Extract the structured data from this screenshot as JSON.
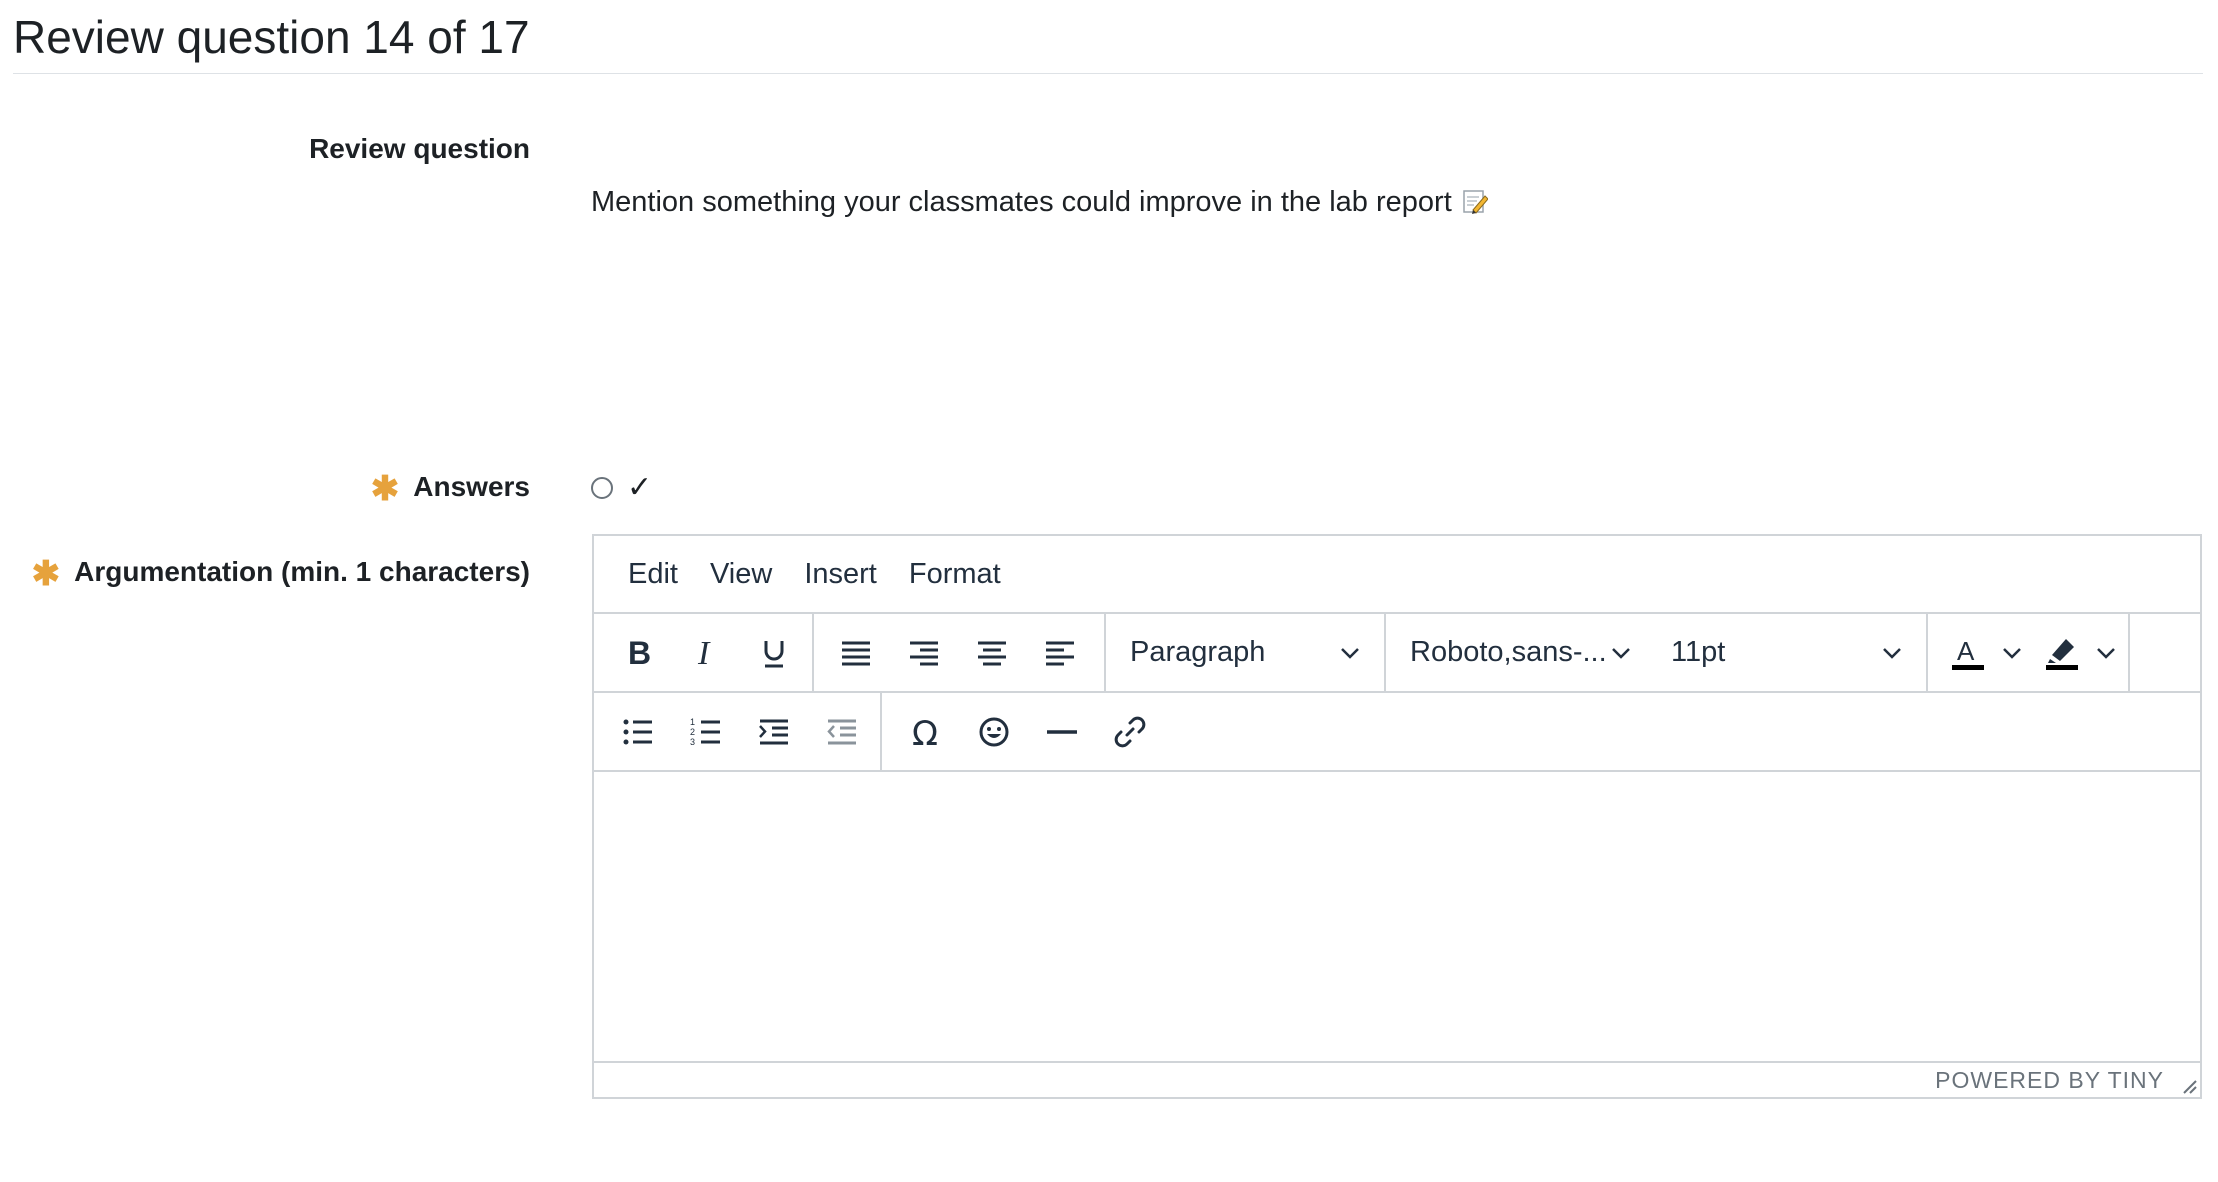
{
  "header": {
    "title": "Review question 14 of 17"
  },
  "question": {
    "label": "Review question",
    "text": "Mention something your classmates could improve in the lab report",
    "emoji_icon": "memo-icon"
  },
  "answers": {
    "label": "Answers",
    "option_label": "✓"
  },
  "argumentation": {
    "label": "Argumentation (min. 1 characters)"
  },
  "editor": {
    "menu": [
      "Edit",
      "View",
      "Insert",
      "Format"
    ],
    "block_format": "Paragraph",
    "font_family": "Roboto,sans-...",
    "font_size": "11pt",
    "powered_by": "POWERED BY TINY"
  },
  "colors": {
    "required": "#e6a23c",
    "border": "#d0d4d8",
    "text": "#1d2125"
  }
}
